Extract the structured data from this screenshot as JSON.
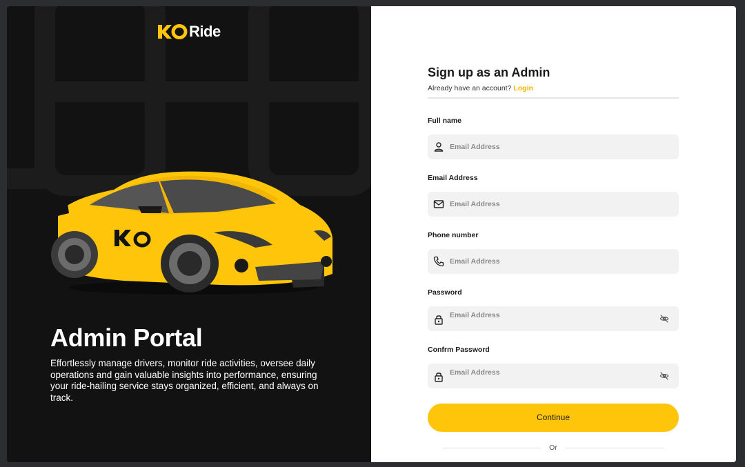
{
  "brand": {
    "name": "Ride",
    "accent": "#ffc50a",
    "logo_letters": "KO"
  },
  "hero": {
    "title": "Admin Portal",
    "description": "Effortlessly manage drivers, monitor ride activities, oversee daily operations and gain valuable insights into performance, ensuring your ride-hailing service stays organized, efficient, and always on track."
  },
  "form": {
    "title": "Sign up as an Admin",
    "have_account": "Already have an account?",
    "login_label": "Login",
    "fields": [
      {
        "label": "Full name",
        "placeholder": "Email Address",
        "icon": "user-icon"
      },
      {
        "label": "Email Address",
        "placeholder": "Email Address",
        "icon": "mail-icon"
      },
      {
        "label": "Phone number",
        "placeholder": "Email Address",
        "icon": "phone-icon"
      },
      {
        "label": "Password",
        "placeholder": "Email Address",
        "icon": "lock-icon",
        "toggle_icon": "eye-off-icon"
      },
      {
        "label": "Confrm Password",
        "placeholder": "Email Address",
        "icon": "lock-icon",
        "toggle_icon": "eye-off-icon"
      }
    ],
    "continue_label": "Continue",
    "or_label": "Or"
  }
}
